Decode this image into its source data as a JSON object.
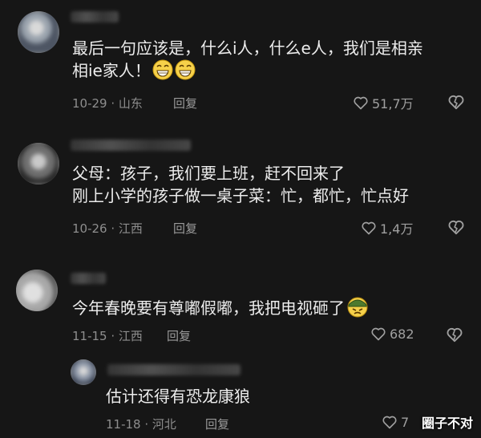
{
  "comments": [
    {
      "username": "",
      "lines": [
        "最后一句应该是，什么i人，什么e人，我们是相亲",
        "相ie家人！"
      ],
      "emoji": [
        "grin-icon",
        "grin-icon"
      ],
      "date_location": "10-29 · 山东",
      "reply": "回复",
      "likes": "51,7万"
    },
    {
      "username": "",
      "lines": [
        "父母：孩子，我们要上班，赶不回来了",
        "刚上小学的孩子做一桌子菜：忙，都忙，忙点好"
      ],
      "date_location": "10-26 · 江西",
      "reply": "回复",
      "likes": "1,4万"
    },
    {
      "username": "",
      "lines": [
        "今年春晚要有尊嘟假嘟，我把电视砸了"
      ],
      "emoji": [
        "angry-soldier-icon"
      ],
      "date_location": "11-15 · 江西",
      "reply": "回复",
      "likes": "682"
    },
    {
      "username": "",
      "lines": [
        "估计还得有恐龙康狼"
      ],
      "date_location": "11-18 · 河北",
      "reply": "回复",
      "likes": "7"
    }
  ],
  "watermark": "圈子不对",
  "colors": {
    "background": "#161616",
    "text": "#ececec",
    "meta": "#8e8e8e"
  }
}
